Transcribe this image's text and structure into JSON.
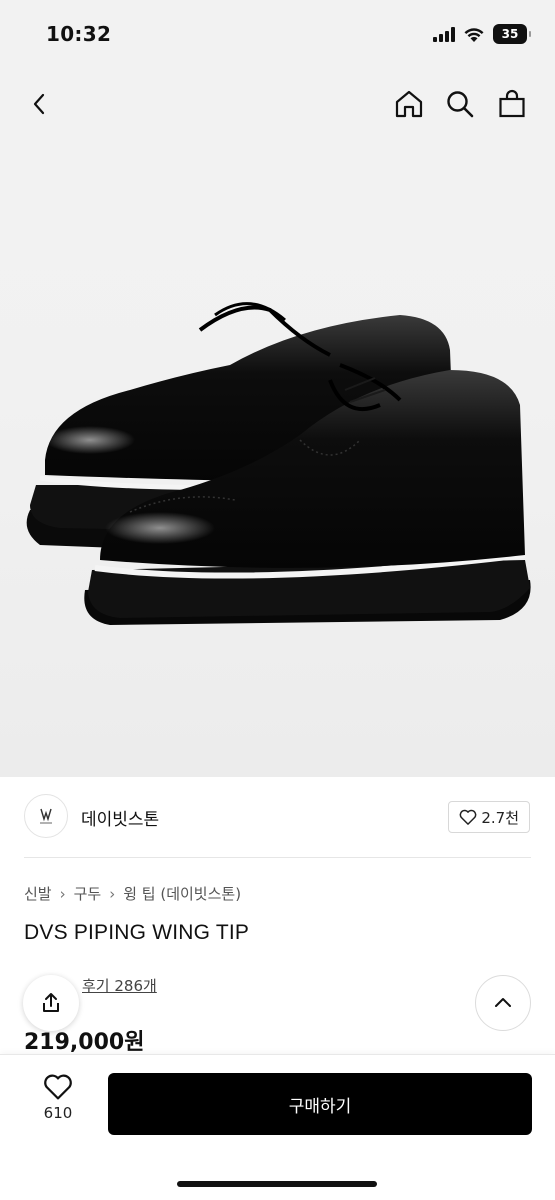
{
  "status": {
    "time": "10:32",
    "battery": "35"
  },
  "nav": {
    "back_icon": "chevron-left-icon",
    "home_icon": "home-icon",
    "search_icon": "search-icon",
    "cart_icon": "shopping-bag-icon"
  },
  "product_image": {
    "alt": ""
  },
  "brand": {
    "name": "데이빗스톤",
    "likes": "2.7천",
    "logo_icon": "brand-logo-icon"
  },
  "breadcrumb": [
    "신발",
    "구두",
    "윙 팁 (데이빗스톤)"
  ],
  "product": {
    "title": "DVS PIPING WING TIP",
    "review_text": "후기 286개",
    "price": "219,000원"
  },
  "actions": {
    "wish_count": "610",
    "buy_label": "구매하기"
  },
  "colors": {
    "primary": "#000000",
    "background": "#ffffff",
    "image_bg": "#f2f2f2"
  }
}
